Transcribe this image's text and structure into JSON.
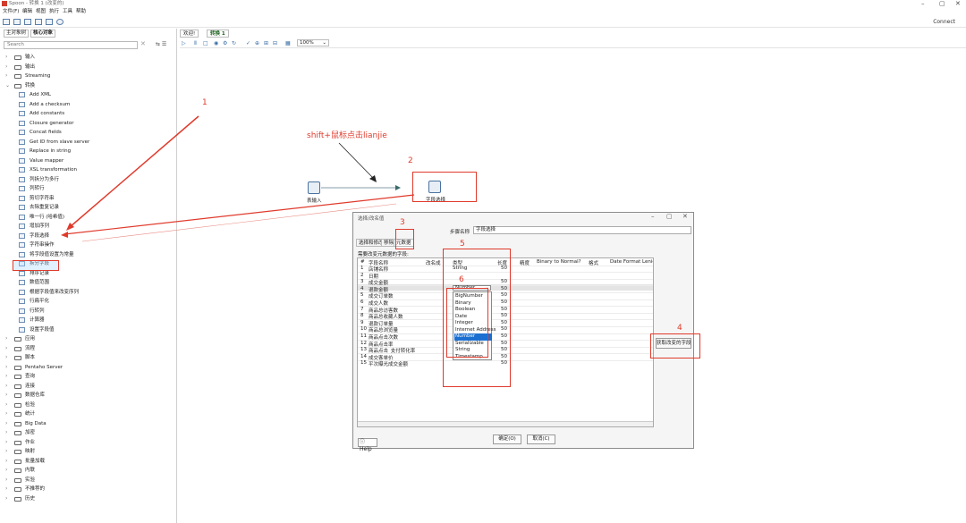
{
  "window": {
    "title": "Spoon - 转换 1 (改变的)",
    "minimize_glyph": "–",
    "maximize_glyph": "▢",
    "close_glyph": "✕"
  },
  "menu": [
    "文件(F)",
    "编辑",
    "视图",
    "执行",
    "工具",
    "帮助"
  ],
  "toolbar": {
    "connect_label": "Connect"
  },
  "left_panel": {
    "tabs": [
      "主对象树",
      "核心对象"
    ],
    "search_placeholder": "Search",
    "tree_top": [
      {
        "label": "输入",
        "expanded": false
      },
      {
        "label": "输出",
        "expanded": false
      },
      {
        "label": "Streaming",
        "expanded": false
      },
      {
        "label": "转换",
        "expanded": true
      }
    ],
    "transform_items": [
      "Add XML",
      "Add a checksum",
      "Add constants",
      "Closure generator",
      "Concat fields",
      "Get ID from slave server",
      "Replace in string",
      "Value mapper",
      "XSL transformation",
      "列拆分为多行",
      "列转行",
      "剪切字符串",
      "去除重复记录",
      "唯一行 (哈希值)",
      "增加序列",
      "字段选择",
      "字符串操作",
      "将字段值设置为常量",
      "拆分字段",
      "排序记录",
      "数值范围",
      "根据字段值来改变序列",
      "行扁平化",
      "行转列",
      "计算器",
      "设置字段值"
    ],
    "tree_bottom": [
      "应用",
      "流程",
      "脚本",
      "Pentaho Server",
      "查询",
      "连接",
      "数据仓库",
      "检验",
      "统计",
      "Big Data",
      "加密",
      "作业",
      "映射",
      "批量加载",
      "内联",
      "实验",
      "不推荐的",
      "历史"
    ]
  },
  "editor": {
    "tabs": [
      "欢迎!",
      "转换 1"
    ],
    "zoom": "100%",
    "step_table_input": "表输入",
    "step_select_values": "字段选择"
  },
  "annotations": {
    "n1": "1",
    "n2": "2",
    "n3": "3",
    "n4": "4",
    "n5": "5",
    "n6": "6",
    "hint": "shift+鼠标点击lianjie"
  },
  "dialog": {
    "title": "选择/改名值",
    "step_name_label": "步骤名称",
    "step_name_value": "字段选择",
    "tabs": [
      "选择和修改",
      "移除",
      "元数据"
    ],
    "fields_label": "需要改变元数据的字段:",
    "columns": [
      "#",
      "字段名称",
      "改名成",
      "类型",
      "长度",
      "精度",
      "Binary to Normal?",
      "格式",
      "Date Format Lenient?"
    ],
    "rows": [
      {
        "n": "1",
        "name": "店铺名称",
        "type": "String",
        "len": "50"
      },
      {
        "n": "2",
        "name": "日期",
        "type": "",
        "len": ""
      },
      {
        "n": "3",
        "name": "成交金额",
        "type": "Number",
        "len": "50"
      },
      {
        "n": "4",
        "name": "退款金额",
        "type": "",
        "len": "50"
      },
      {
        "n": "5",
        "name": "成交订单数",
        "type": "",
        "len": "50"
      },
      {
        "n": "6",
        "name": "成交人数",
        "type": "",
        "len": "50"
      },
      {
        "n": "7",
        "name": "商品总访客数",
        "type": "",
        "len": "50"
      },
      {
        "n": "8",
        "name": "商品总收藏人数",
        "type": "",
        "len": "50"
      },
      {
        "n": "9",
        "name": "退款订单量",
        "type": "",
        "len": "50"
      },
      {
        "n": "10",
        "name": "商品总浏览量",
        "type": "",
        "len": "50"
      },
      {
        "n": "11",
        "name": "商品点击次数",
        "type": "",
        "len": "50"
      },
      {
        "n": "12",
        "name": "商品点击率",
        "type": "",
        "len": "50"
      },
      {
        "n": "13",
        "name": "商品点击_支付转化率",
        "type": "",
        "len": "50"
      },
      {
        "n": "14",
        "name": "成交客单价",
        "type": "",
        "len": "50"
      },
      {
        "n": "15",
        "name": "平次曝光成交金额",
        "type": "",
        "len": "50"
      }
    ],
    "type_options": [
      "BigNumber",
      "Binary",
      "Boolean",
      "Date",
      "Integer",
      "Internet Address",
      "Number",
      "Serializable",
      "String",
      "Timestamp"
    ],
    "selected_type": "Number",
    "get_fields_button": "获取改变的字段",
    "help_button": "Help",
    "ok_button": "确定(O)",
    "cancel_button": "取消(C)"
  },
  "colors": {
    "annotation_red": "#e03a2c",
    "selection_blue": "#1b6fd1"
  }
}
